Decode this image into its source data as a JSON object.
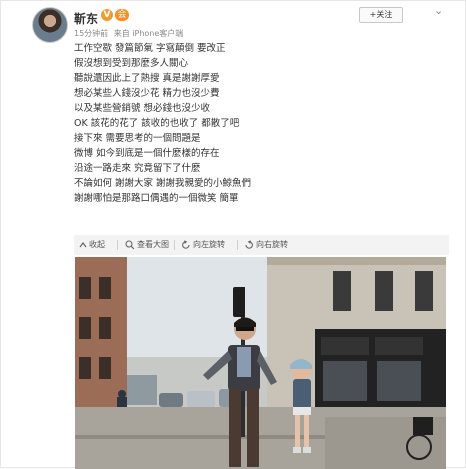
{
  "post": {
    "username": "靳东",
    "verified_mark": "V",
    "vip_mark": "会",
    "time": "15分钟前",
    "source": "来自 iPhone客户端",
    "follow_label": "+关注",
    "menu_glyph": "⌄",
    "lines": [
      "工作空歇 發篇節氣 字寫顛倒 要改正",
      "假沒想到受到那麼多人關心",
      "聽說還因此上了熱搜 真是謝謝厚愛",
      "想必某些人錢沒少花 精力也沒少費",
      "以及某些營銷號 想必錢也沒少收",
      "OK 該花的花了 該收的也收了 都散了吧",
      "接下來 需要思考的一個問題是",
      "微博 如今到底是一個什麼樣的存在",
      "沿途一路走來 究竟留下了什麼",
      "不論如何 謝謝大家 謝謝我親愛的小鯨魚們",
      "謝謝哪怕是那路口偶遇的一個微笑 簡單"
    ]
  },
  "actions": {
    "collapse": "收起",
    "view_large": "查看大图",
    "rotate_left": "向左旋转",
    "rotate_right": "向右旋转"
  },
  "colors": {
    "accent_orange": "#f06d1e",
    "text_main": "#333333",
    "text_meta": "#8a8a8a"
  }
}
